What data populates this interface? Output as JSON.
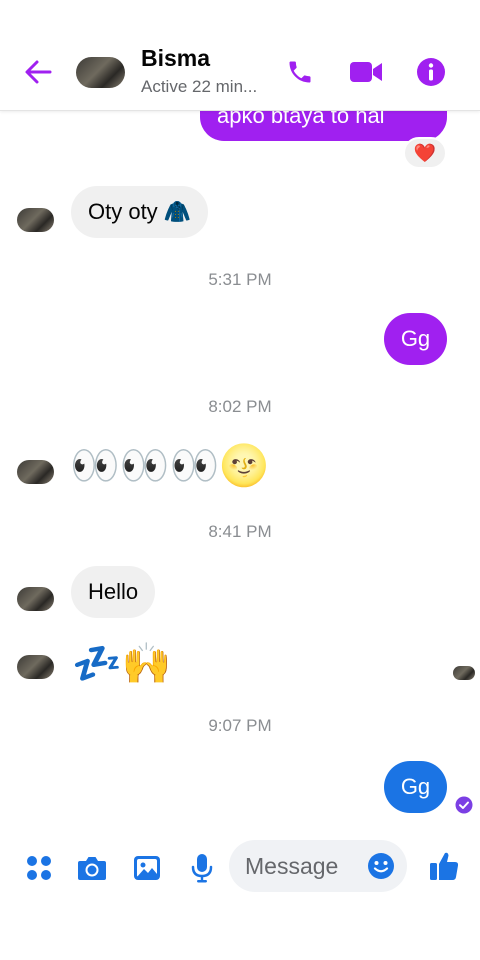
{
  "header": {
    "back_icon": "arrow-left-icon",
    "contact_name": "Bisma",
    "status": "Active 22 min...",
    "icons": [
      "phone-icon",
      "video-camera-icon",
      "info-icon"
    ],
    "accent": "#a020f0"
  },
  "thread": {
    "partial_outgoing": {
      "text": "apko btaya to hai",
      "reaction": "❤️"
    },
    "msg1": {
      "text": "Oty oty 🧥"
    },
    "time1": "5:31 PM",
    "msg2": {
      "text": "Gg"
    },
    "time2": "8:02 PM",
    "msg3": {
      "text": "👀👀👀🌝"
    },
    "time3": "8:41 PM",
    "msg4": {
      "text": "Hello"
    },
    "msg5": {
      "text": "💤🙌"
    },
    "time4": "9:07 PM",
    "msg6": {
      "text": "Gg",
      "status_icon": "delivered-check-icon"
    }
  },
  "composer": {
    "placeholder": "Message",
    "icons": [
      "menu-dots-icon",
      "camera-icon",
      "image-icon",
      "microphone-icon",
      "emoji-icon",
      "thumbs-up-icon"
    ],
    "accent": "#1b74e4"
  }
}
